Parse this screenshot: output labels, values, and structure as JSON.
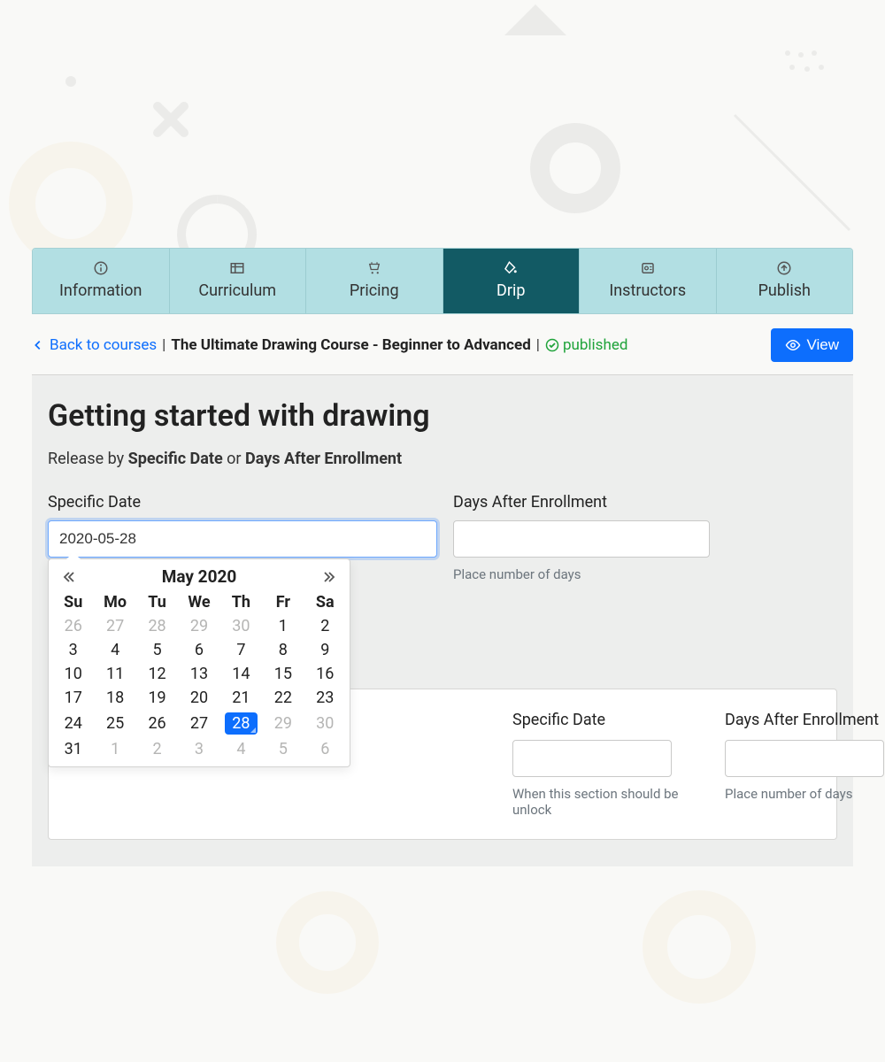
{
  "tabs": [
    {
      "label": "Information",
      "icon": "info-icon"
    },
    {
      "label": "Curriculum",
      "icon": "table-icon"
    },
    {
      "label": "Pricing",
      "icon": "cart-icon"
    },
    {
      "label": "Drip",
      "icon": "fill-icon",
      "active": true
    },
    {
      "label": "Instructors",
      "icon": "badge-icon"
    },
    {
      "label": "Publish",
      "icon": "upload-icon"
    }
  ],
  "breadcrumb": {
    "back_label": "Back to courses",
    "course_title": "The Ultimate Drawing Course - Beginner to Advanced",
    "status_label": "published"
  },
  "view_button": "View",
  "panel": {
    "heading": "Getting started with drawing",
    "release_prefix": "Release by ",
    "release_bold1": "Specific Date",
    "release_or": " or ",
    "release_bold2": "Days After Enrollment"
  },
  "form": {
    "specific_date_label": "Specific Date",
    "specific_date_value": "2020-05-28",
    "specific_date_helper": "When this section should be unlock",
    "days_label": "Days After Enrollment",
    "days_value": "",
    "days_helper": "Place number of days"
  },
  "datepicker": {
    "title": "May 2020",
    "weekdays": [
      "Su",
      "Mo",
      "Tu",
      "We",
      "Th",
      "Fr",
      "Sa"
    ],
    "weeks": [
      [
        {
          "d": "26",
          "muted": true
        },
        {
          "d": "27",
          "muted": true
        },
        {
          "d": "28",
          "muted": true
        },
        {
          "d": "29",
          "muted": true
        },
        {
          "d": "30",
          "muted": true
        },
        {
          "d": "1"
        },
        {
          "d": "2"
        }
      ],
      [
        {
          "d": "3"
        },
        {
          "d": "4"
        },
        {
          "d": "5"
        },
        {
          "d": "6"
        },
        {
          "d": "7"
        },
        {
          "d": "8"
        },
        {
          "d": "9"
        }
      ],
      [
        {
          "d": "10"
        },
        {
          "d": "11"
        },
        {
          "d": "12"
        },
        {
          "d": "13"
        },
        {
          "d": "14"
        },
        {
          "d": "15"
        },
        {
          "d": "16"
        }
      ],
      [
        {
          "d": "17"
        },
        {
          "d": "18"
        },
        {
          "d": "19"
        },
        {
          "d": "20"
        },
        {
          "d": "21"
        },
        {
          "d": "22"
        },
        {
          "d": "23"
        }
      ],
      [
        {
          "d": "24"
        },
        {
          "d": "25"
        },
        {
          "d": "26"
        },
        {
          "d": "27"
        },
        {
          "d": "28",
          "selected": true
        },
        {
          "d": "29",
          "muted": true
        },
        {
          "d": "30",
          "muted": true
        }
      ],
      [
        {
          "d": "31"
        },
        {
          "d": "1",
          "muted": true
        },
        {
          "d": "2",
          "muted": true
        },
        {
          "d": "3",
          "muted": true
        },
        {
          "d": "4",
          "muted": true
        },
        {
          "d": "5",
          "muted": true
        },
        {
          "d": "6",
          "muted": true
        }
      ]
    ]
  },
  "section_card": {
    "specific_date_label": "Specific Date",
    "specific_date_helper": "When this section should be unlock",
    "days_label": "Days After Enrollment",
    "days_helper": "Place number of days"
  }
}
